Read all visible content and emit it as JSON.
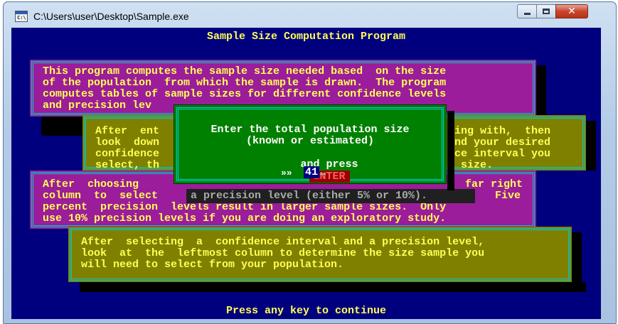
{
  "window": {
    "title": "C:\\Users\\user\\Desktop\\Sample.exe",
    "icon_label": "C:\\",
    "controls": {
      "minimize": "minimize-icon",
      "maximize": "maximize-icon",
      "close": "close-icon"
    }
  },
  "console": {
    "heading": "Sample Size Computation Program",
    "box1": [
      "This program computes the sample size needed based  on the size",
      "of the population  from which the sample is drawn.  The program",
      "computes tables of sample sizes for different confidence levels",
      "and precision lev"
    ],
    "box2": [
      "After  ent",
      "look  down",
      "confidence",
      "select, th"
    ],
    "box2_right": [
      "king with,  then",
      "ind your desired",
      "nce interval you",
      "e size."
    ],
    "box3_left": "After  choosing",
    "box3_right": "far right",
    "box3_lines": [
      "column  to  select",
      "percent  precision  levels result in larger sample sizes.  Only",
      "use 10% precision levels if you are doing an exploratory study."
    ],
    "precision_strip": "a precision level (either 5% or 10%).",
    "box3_five": "Five",
    "box4": [
      "After  selecting  a  confidence interval and a precision level,",
      "look  at  the  leftmost column to determine the size sample you",
      "will need to select from your population."
    ],
    "footer": "Press any key to continue"
  },
  "dialog": {
    "line1": "Enter the total population size",
    "line2": "(known or estimated)",
    "line3_prefix": "and press",
    "enter_key": "ENTER",
    "prompt": "»»",
    "answer": "41"
  },
  "colors": {
    "console_bg": "#00007f",
    "magenta_box": "#9b1d9b",
    "olive_box": "#808000",
    "dialog_bg": "#008000",
    "text_yellow": "#ffff55",
    "border_cyan": "#00c8c8"
  }
}
